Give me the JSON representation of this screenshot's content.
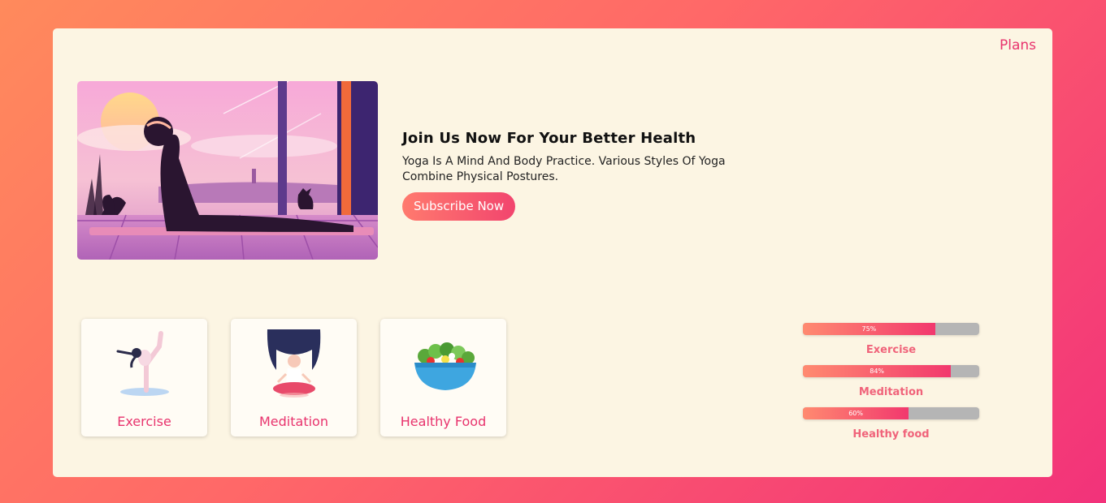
{
  "nav": {
    "plans": "Plans"
  },
  "hero": {
    "title": "Join Us Now For Your Better Health",
    "description": "Yoga Is A Mind And Body Practice. Various Styles Of Yoga Combine Physical Postures.",
    "button": "Subscribe Now"
  },
  "tiles": [
    {
      "label": "Exercise",
      "icon": "yoga-pose-icon"
    },
    {
      "label": "Meditation",
      "icon": "meditation-icon"
    },
    {
      "label": "Healthy Food",
      "icon": "salad-bowl-icon"
    }
  ],
  "progress": [
    {
      "label": "Exercise",
      "percent": 75,
      "text": "75%"
    },
    {
      "label": "Meditation",
      "percent": 84,
      "text": "84%"
    },
    {
      "label": "Healthy food",
      "percent": 60,
      "text": "60%"
    }
  ],
  "colors": {
    "accent": "#e8336d",
    "card_bg": "#fcf5e3",
    "bar_track": "#b5b5b5",
    "bar_label": "#f0637a"
  }
}
